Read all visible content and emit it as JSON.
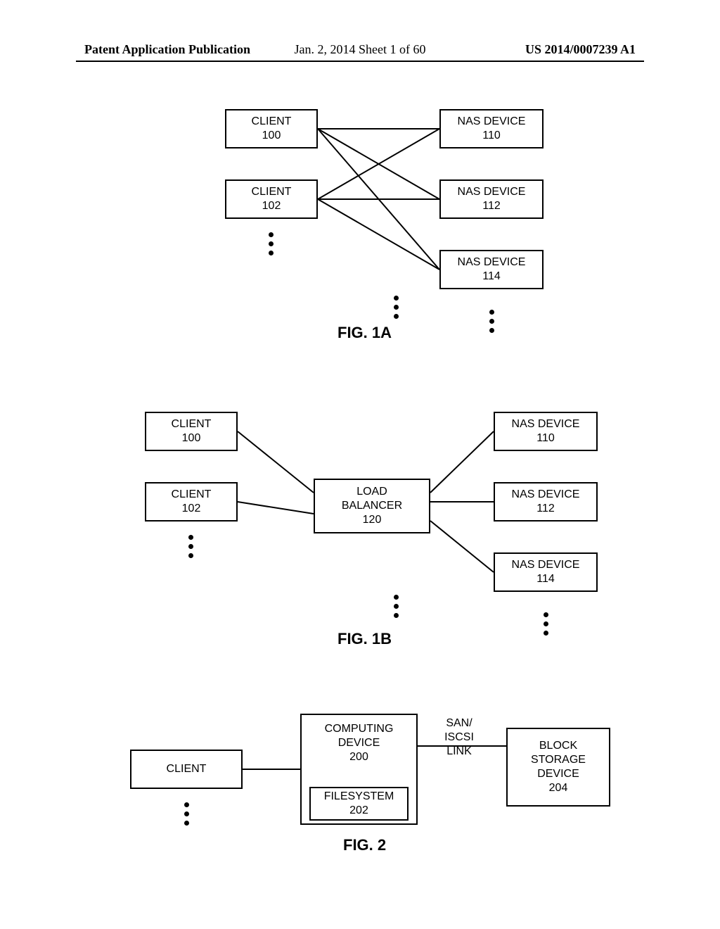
{
  "header": {
    "left": "Patent Application Publication",
    "center": "Jan. 2, 2014   Sheet 1 of 60",
    "right": "US 2014/0007239 A1"
  },
  "fig1a": {
    "label": "FIG. 1A",
    "client1": {
      "name": "CLIENT",
      "num": "100"
    },
    "client2": {
      "name": "CLIENT",
      "num": "102"
    },
    "nas1": {
      "name": "NAS DEVICE",
      "num": "110"
    },
    "nas2": {
      "name": "NAS DEVICE",
      "num": "112"
    },
    "nas3": {
      "name": "NAS DEVICE",
      "num": "114"
    }
  },
  "fig1b": {
    "label": "FIG. 1B",
    "client1": {
      "name": "CLIENT",
      "num": "100"
    },
    "client2": {
      "name": "CLIENT",
      "num": "102"
    },
    "lb": {
      "name": "LOAD",
      "name2": "BALANCER",
      "num": "120"
    },
    "nas1": {
      "name": "NAS DEVICE",
      "num": "110"
    },
    "nas2": {
      "name": "NAS DEVICE",
      "num": "112"
    },
    "nas3": {
      "name": "NAS DEVICE",
      "num": "114"
    }
  },
  "fig2": {
    "label": "FIG. 2",
    "client": {
      "name": "CLIENT"
    },
    "compdev": {
      "name": "COMPUTING",
      "name2": "DEVICE",
      "num": "200"
    },
    "fs": {
      "name": "FILESYSTEM",
      "num": "202"
    },
    "link": {
      "l1": "SAN/",
      "l2": "ISCSI",
      "l3": "LINK"
    },
    "block": {
      "name": "BLOCK",
      "name2": "STORAGE",
      "name3": "DEVICE",
      "num": "204"
    }
  }
}
